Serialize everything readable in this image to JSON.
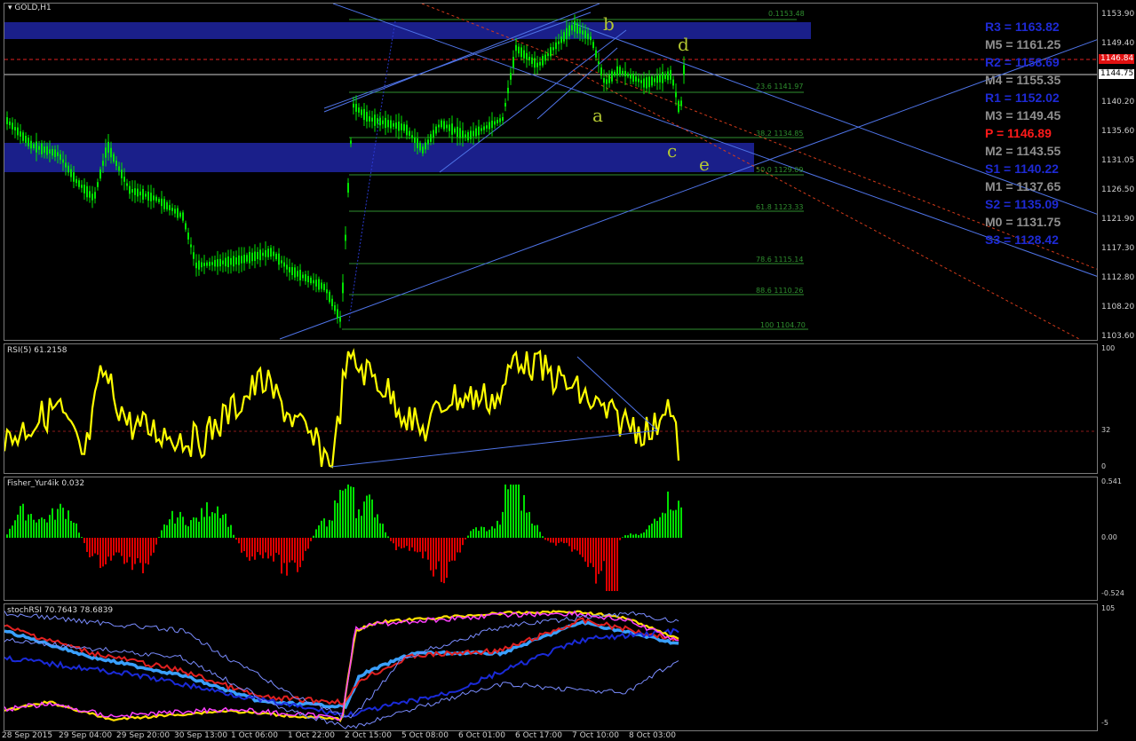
{
  "chart": {
    "symbol_title": "GOLD,H1",
    "current_price": "1146.84",
    "hline_price": "1144.75",
    "price_axis": [
      "1153.90",
      "1149.40",
      "1144.75",
      "1140.20",
      "1135.60",
      "1131.05",
      "1126.50",
      "1121.90",
      "1117.30",
      "1112.80",
      "1108.20",
      "1103.60"
    ],
    "time_axis": [
      "28 Sep 2015",
      "29 Sep 04:00",
      "29 Sep 20:00",
      "30 Sep 13:00",
      "1 Oct 06:00",
      "1 Oct 22:00",
      "2 Oct 15:00",
      "5 Oct 08:00",
      "6 Oct 01:00",
      "6 Oct 17:00",
      "7 Oct 10:00",
      "8 Oct 03:00"
    ],
    "pivots": [
      {
        "label": "R3 = 1163.82",
        "color": "#1e2ad4"
      },
      {
        "label": "M5 = 1161.25",
        "color": "#8f8f8f"
      },
      {
        "label": "R2 = 1158.69",
        "color": "#1e2ad4"
      },
      {
        "label": "M4 = 1155.35",
        "color": "#8f8f8f"
      },
      {
        "label": "R1 = 1152.02",
        "color": "#1e2ad4"
      },
      {
        "label": "M3 = 1149.45",
        "color": "#8f8f8f"
      },
      {
        "label": "P  = 1146.89",
        "color": "#ff1a1a"
      },
      {
        "label": "M2 = 1143.55",
        "color": "#8f8f8f"
      },
      {
        "label": "S1 = 1140.22",
        "color": "#1e2ad4"
      },
      {
        "label": "M1 = 1137.65",
        "color": "#8f8f8f"
      },
      {
        "label": "S2 = 1135.09",
        "color": "#1e2ad4"
      },
      {
        "label": "M0 = 1131.75",
        "color": "#8f8f8f"
      },
      {
        "label": "S3 = 1128.42",
        "color": "#1e2ad4"
      }
    ],
    "fib_levels": [
      "0.1153.48",
      "23.6 1141.97",
      "38.2 1134.85",
      "50.0 1129.09",
      "61.8 1123.33",
      "78.6 1115.14",
      "88.6 1110.26",
      "100 1104.70"
    ],
    "wave_labels": [
      "b",
      "d",
      "a",
      "c",
      "e"
    ]
  },
  "rsi": {
    "title": "RSI(5) 61.2158",
    "levels": [
      "100",
      "32",
      "0"
    ]
  },
  "fisher": {
    "title": "Fisher_Yur4ik 0.032",
    "levels": [
      "0.541",
      "0.00",
      "-0.524"
    ]
  },
  "stochrsi": {
    "title": "stochRSI 70.7643 78.6839",
    "levels": [
      "105",
      "-5"
    ]
  },
  "colors": {
    "candle": "#00e600",
    "zone": "#1a1f8a",
    "trendline": "#4f74e8",
    "fib": "#2f8f2f",
    "rsi": "#ffff00",
    "fisher_up": "#00e000",
    "fisher_down": "#e00000"
  }
}
